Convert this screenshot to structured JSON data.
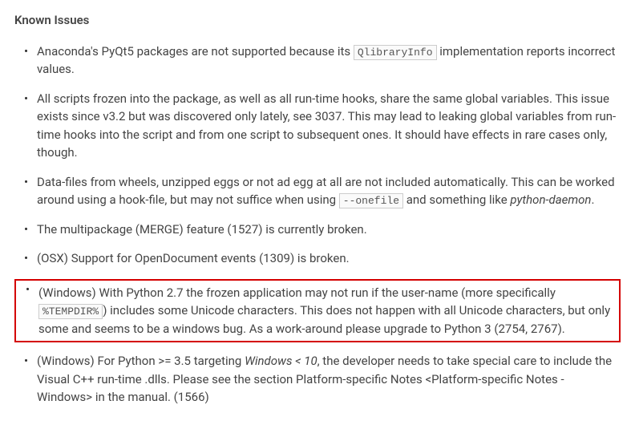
{
  "heading": "Known Issues",
  "items": {
    "i0": {
      "pre1": "Anaconda's PyQt5 packages are not supported because its ",
      "code1": "QlibraryInfo",
      "post1": " implementation reports incorrect values."
    },
    "i1": {
      "text": "All scripts frozen into the package, as well as all run-time hooks, share the same global variables. This issue exists since v3.2 but was discovered only lately, see 3037. This may lead to leaking global variables from run-time hooks into the script and from one script to subsequent ones. It should have effects in rare cases only, though."
    },
    "i2": {
      "pre1": "Data-files from wheels, unzipped eggs or not ad egg at all are not included automatically. This can be worked around using a hook-file, but may not suffice when using ",
      "code1": "--onefile",
      "mid1": " and something like ",
      "italic1": "python-daemon",
      "post1": "."
    },
    "i3": {
      "text": "The multipackage (MERGE) feature (1527) is currently broken."
    },
    "i4": {
      "text": "(OSX) Support for OpenDocument events (1309) is broken."
    },
    "i5": {
      "pre1": "(Windows) With Python 2.7 the frozen application may not run if the user-name (more specifically ",
      "code1": "%TEMPDIR%",
      "post1": ") includes some Unicode characters. This does not happen with all Unicode characters, but only some and seems to be a windows bug. As a work-around please upgrade to Python 3 (2754, 2767)."
    },
    "i6": {
      "pre1": "(Windows) For Python >= 3.5 targeting ",
      "italic1": "Windows < 10",
      "post1": ", the developer needs to take special care to include the Visual C++ run-time .dlls. Please see the section Platform-specific Notes <Platform-specific Notes - Windows> in the manual. (1566)"
    }
  }
}
